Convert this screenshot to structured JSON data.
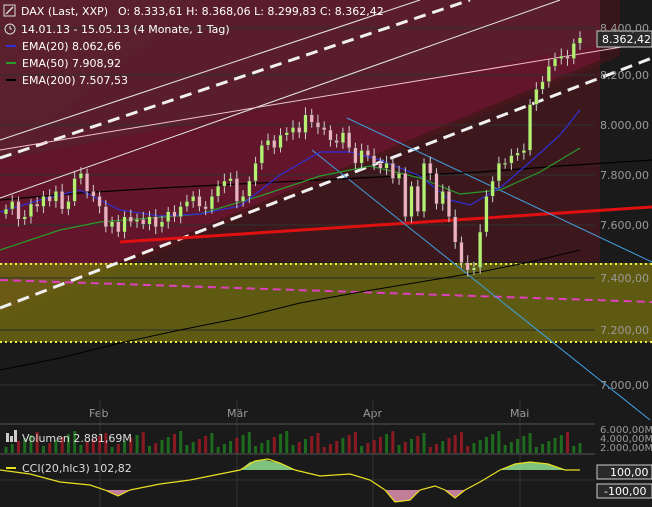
{
  "header": {
    "instrument": "DAX (Last, XXP)",
    "ohlc": "O: 8.333,61  H: 8.368,06  L: 8.299,83  C: 8.362,42",
    "period": "14.01.13 - 15.05.13 (4 Monate, 1 Tag)",
    "ema20": "EMA(20)  8.062,66",
    "ema50": "EMA(50)  7.908,92",
    "ema200": "EMA(200)  7.507,53"
  },
  "price_tag": "8.362,42",
  "volume_label": "Volumen  2.881,69M",
  "cci_label": "CCI(20,hlc3)  102,82",
  "colors": {
    "background": "#1a1a1a",
    "ema20": "#3030d8",
    "ema50": "#2a9a2a",
    "ema200": "#000000",
    "support_line": "#e01010",
    "zone_fill": "#6b6610",
    "channel_fill": "#6e1238",
    "top_band": "#1e6a1e",
    "cci_line": "#e8e020"
  },
  "chart_data": {
    "type": "candlestick",
    "x_labels": [
      "Feb",
      "Mär",
      "Apr",
      "Mai"
    ],
    "y_ticks": [
      "8.400,00",
      "8.200,00",
      "8.000,00",
      "7.800,00",
      "7.600,00",
      "7.400,00",
      "7.200,00",
      "7.000,00"
    ],
    "volume_ticks": [
      "6.000,00M",
      "4.000,00M",
      "2.000,00M"
    ],
    "cci_ticks": [
      "100,00",
      "-100,00"
    ],
    "ylim": [
      6950,
      8450
    ],
    "series": [
      {
        "name": "EMA(20)",
        "last": 8062.66
      },
      {
        "name": "EMA(50)",
        "last": 7908.92
      },
      {
        "name": "EMA(200)",
        "last": 7507.53
      }
    ],
    "close": [
      7690,
      7720,
      7650,
      7660,
      7710,
      7700,
      7740,
      7720,
      7760,
      7690,
      7720,
      7810,
      7830,
      7760,
      7740,
      7700,
      7620,
      7640,
      7600,
      7660,
      7640,
      7650,
      7630,
      7660,
      7620,
      7640,
      7680,
      7660,
      7700,
      7720,
      7740,
      7700,
      7690,
      7740,
      7780,
      7800,
      7810,
      7720,
      7740,
      7800,
      7870,
      7940,
      7960,
      7930,
      7980,
      7990,
      8010,
      7990,
      8060,
      8030,
      8010,
      8000,
      7960,
      7950,
      7990,
      7930,
      7870,
      7920,
      7900,
      7870,
      7850,
      7870,
      7810,
      7830,
      7660,
      7780,
      7680,
      7870,
      7830,
      7710,
      7760,
      7660,
      7560,
      7480,
      7450,
      7460,
      7600,
      7740,
      7800,
      7870,
      7870,
      7900,
      7910,
      7920,
      8100,
      8160,
      8190,
      8250,
      8280,
      8290,
      8280,
      8340,
      8362
    ]
  }
}
